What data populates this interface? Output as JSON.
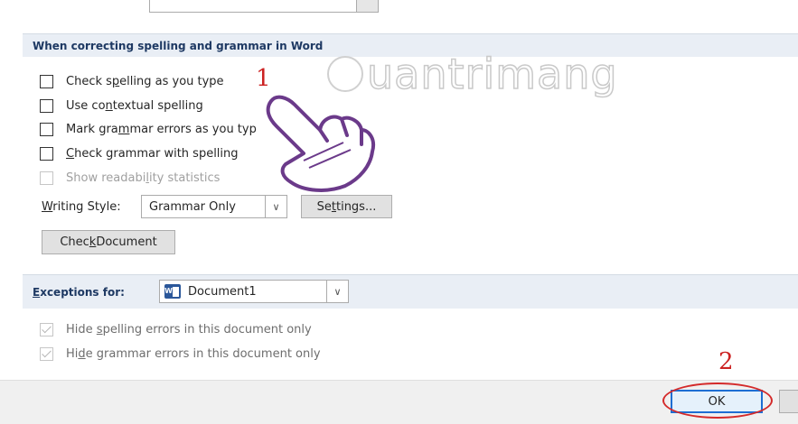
{
  "spelling_section": {
    "header": "When correcting spelling and grammar in Word",
    "options": [
      {
        "pre": "Check s",
        "key": "p",
        "post": "elling as you type",
        "checked": false,
        "disabled": false
      },
      {
        "pre": "Use co",
        "key": "n",
        "post": "textual spelling",
        "checked": false,
        "disabled": false
      },
      {
        "pre": "Mark gra",
        "key": "m",
        "post": "mar errors as you typ",
        "checked": false,
        "disabled": false
      },
      {
        "pre": "",
        "key": "C",
        "post": "heck grammar with spelling",
        "checked": false,
        "disabled": false
      },
      {
        "pre": "Show readabi",
        "key": "l",
        "post": "ity statistics",
        "checked": false,
        "disabled": true
      }
    ],
    "writing_style": {
      "pre": "",
      "key": "W",
      "post": "riting Style:",
      "value": "Grammar Only"
    },
    "settings_button": {
      "pre": "Se",
      "key": "t",
      "post": "tings..."
    },
    "check_document_button": {
      "pre": "Chec",
      "key": "k",
      "post": " Document"
    }
  },
  "exceptions_section": {
    "label": {
      "pre": "",
      "key": "E",
      "post": "xceptions for:"
    },
    "document": "Document1",
    "options": [
      {
        "pre": "Hide ",
        "key": "s",
        "post": "pelling errors in this document only",
        "checked": true,
        "disabled": true
      },
      {
        "pre": "Hi",
        "key": "d",
        "post": "e grammar errors in this document only",
        "checked": true,
        "disabled": true
      }
    ]
  },
  "footer": {
    "ok_label": "OK"
  },
  "annotations": {
    "step1": "1",
    "step2": "2"
  },
  "watermark": {
    "text": "uantrimang"
  },
  "colors": {
    "accent": "#1d6ed3",
    "annotation_red": "#d42a2a",
    "section_bg": "#e9eef5"
  }
}
